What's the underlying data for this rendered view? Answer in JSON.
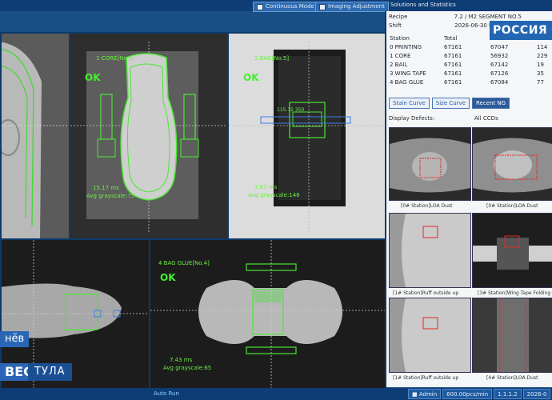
{
  "toolbar": {
    "continuous_mode": "Continuous Mode",
    "imaging_adjustment": "Imaging Adjustment",
    "stats_title": "Solutions and Statistics"
  },
  "stats": {
    "recipe_label": "Recipe",
    "recipe_value": "7.2 / M2 SEGMENT NO.5",
    "shift_label": "Shift",
    "shift_value": "2026-06-30 M",
    "headers": [
      "Station",
      "Total",
      "",
      ""
    ],
    "rows": [
      {
        "name": "0 PRINTING",
        "total": "67161",
        "ok": "67047",
        "ng": "114"
      },
      {
        "name": "1 CORE",
        "total": "67161",
        "ok": "56932",
        "ng": "229"
      },
      {
        "name": "2 BAIL",
        "total": "67161",
        "ok": "67142",
        "ng": "19"
      },
      {
        "name": "3 WING TAPE",
        "total": "67161",
        "ok": "67126",
        "ng": "35"
      },
      {
        "name": "4 BAG GLUE",
        "total": "67161",
        "ok": "67084",
        "ng": "77"
      }
    ]
  },
  "tabs": [
    {
      "label": "Stain Curve"
    },
    {
      "label": "Size Curve"
    },
    {
      "label": "Recent NG"
    }
  ],
  "display_defects_label": "Display Defects:",
  "all_ccds_label": "All CCDs",
  "defect_thumbs": [
    {
      "caption": "[0# Station]LOA Dust"
    },
    {
      "caption": "[0# Station]LOA Dust"
    },
    {
      "caption": "[1# Station]Ruff outside up"
    },
    {
      "caption": "[3# Station]Wing Tape Folding"
    },
    {
      "caption": "[1# Station]Ruff outside up"
    },
    {
      "caption": "[4# Station]LOA Dust"
    }
  ],
  "cameras": {
    "cam1": {
      "title": "1 CORE[No.5]",
      "status": "OK",
      "time": "15.17 ms",
      "grayscale": "Avg grayscale:75"
    },
    "cam2": {
      "title": "2 BAG[No.5]",
      "status": "OK",
      "measure": "115.12 350",
      "time": "7.07 ms",
      "grayscale": "Avg grayscale:146"
    },
    "cam4": {
      "title": "4 BAG GLUE[No.4]",
      "status": "OK",
      "time": "7.43 ms",
      "grayscale": "Avg grayscale:65"
    }
  },
  "status_bar": {
    "auto_run": "Auto Run",
    "user": "Admin",
    "speed": "600.00pcs/min",
    "version": "1.1.1.2",
    "date": "2026-0"
  },
  "broadcast": {
    "channel": "РОССИЯ",
    "vesti": "ВЕСТИ",
    "region": "ТУЛА",
    "name_fragment": "нёв"
  }
}
